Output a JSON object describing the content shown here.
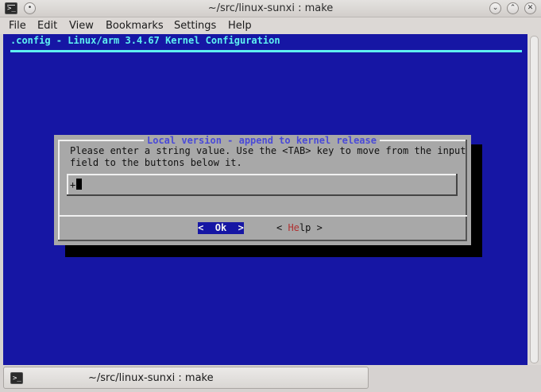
{
  "window": {
    "title": "~/src/linux-sunxi : make",
    "icon": "terminal-icon",
    "icon_glyph": ">_",
    "controls": {
      "menu_glyph": "•",
      "minimize_glyph": "⌄",
      "maximize_glyph": "⌃",
      "close_glyph": "✕"
    }
  },
  "menubar": {
    "items": [
      "File",
      "Edit",
      "View",
      "Bookmarks",
      "Settings",
      "Help"
    ]
  },
  "terminal": {
    "background": "#1616a4",
    "header": ".config - Linux/arm 3.4.67 Kernel Configuration",
    "dialog": {
      "title": "Local version - append to kernel release",
      "prompt": "Please enter a string value. Use the <TAB> key to move from the input\nfield to the buttons below it.",
      "input_value": "+",
      "buttons": {
        "ok": "<  Ok  >",
        "help_prefix": "< ",
        "help_hotkey": "He",
        "help_rest": "lp >"
      }
    }
  },
  "taskbar": {
    "task_label": "~/src/linux-sunxi : make",
    "icon": "terminal-icon",
    "icon_glyph": ">_"
  }
}
